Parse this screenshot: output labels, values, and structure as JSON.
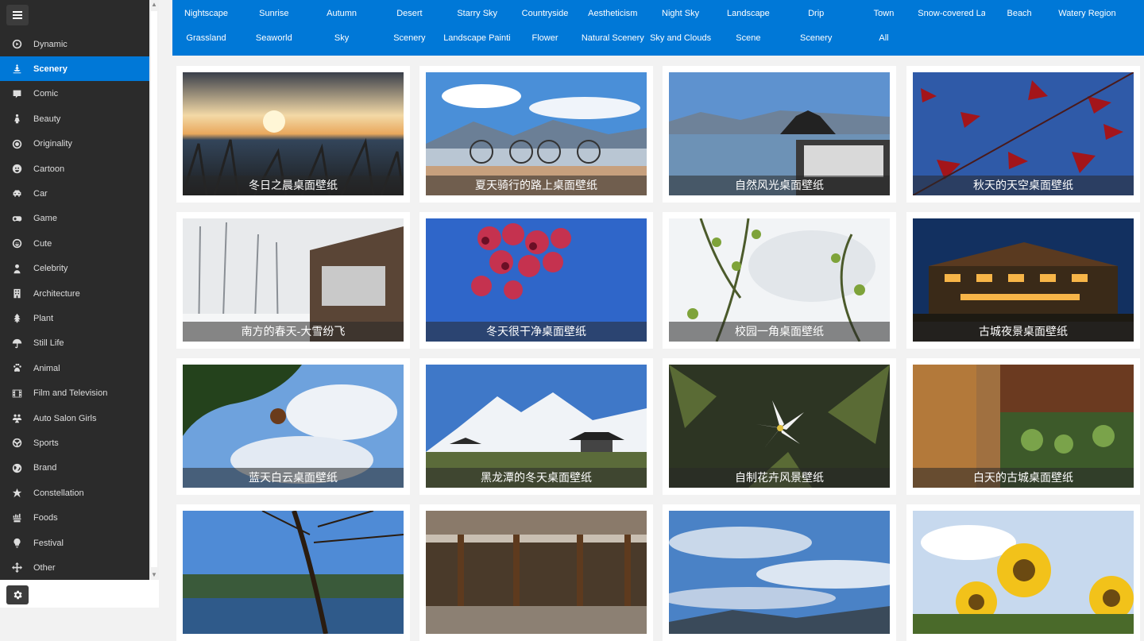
{
  "sidebar": {
    "items": [
      {
        "label": "Dynamic",
        "icon": "play-circle-icon"
      },
      {
        "label": "Scenery",
        "icon": "scenery-icon",
        "active": true
      },
      {
        "label": "Comic",
        "icon": "comic-icon"
      },
      {
        "label": "Beauty",
        "icon": "beauty-icon"
      },
      {
        "label": "Originality",
        "icon": "originality-icon"
      },
      {
        "label": "Cartoon",
        "icon": "cartoon-icon"
      },
      {
        "label": "Car",
        "icon": "car-icon"
      },
      {
        "label": "Game",
        "icon": "gamepad-icon"
      },
      {
        "label": "Cute",
        "icon": "smiley-icon"
      },
      {
        "label": "Celebrity",
        "icon": "person-icon"
      },
      {
        "label": "Architecture",
        "icon": "building-icon"
      },
      {
        "label": "Plant",
        "icon": "tree-icon"
      },
      {
        "label": "Still Life",
        "icon": "umbrella-icon"
      },
      {
        "label": "Animal",
        "icon": "paw-icon"
      },
      {
        "label": "Film and Television",
        "icon": "film-icon"
      },
      {
        "label": "Auto Salon Girls",
        "icon": "group-icon"
      },
      {
        "label": "Sports",
        "icon": "ball-icon"
      },
      {
        "label": "Brand",
        "icon": "globe-icon"
      },
      {
        "label": "Constellation",
        "icon": "star-icon"
      },
      {
        "label": "Foods",
        "icon": "food-icon"
      },
      {
        "label": "Festival",
        "icon": "bulb-icon"
      },
      {
        "label": "Other",
        "icon": "move-icon"
      }
    ]
  },
  "categories": [
    "Nightscape",
    "Sunrise",
    "Autumn",
    "Desert",
    "Starry Sky",
    "Countryside",
    "Aestheticism",
    "Night Sky",
    "Landscape",
    "Drip",
    "Town",
    "Snow-covered Lan",
    "Beach",
    "Watery Region",
    "Grassland",
    "Seaworld",
    "Sky",
    "Scenery",
    "Landscape Paintir",
    "Flower",
    "Natural Scenery",
    "Sky and Clouds",
    "Scene",
    "Scenery",
    "All"
  ],
  "wallpapers": [
    {
      "caption": "冬日之晨桌面壁纸"
    },
    {
      "caption": "夏天骑行的路上桌面壁纸"
    },
    {
      "caption": "自然风光桌面壁纸"
    },
    {
      "caption": "秋天的天空桌面壁纸"
    },
    {
      "caption": "南方的春天-大雪纷飞"
    },
    {
      "caption": "冬天很干净桌面壁纸"
    },
    {
      "caption": "校园一角桌面壁纸"
    },
    {
      "caption": "古城夜景桌面壁纸"
    },
    {
      "caption": "蓝天白云桌面壁纸"
    },
    {
      "caption": "黑龙潭的冬天桌面壁纸"
    },
    {
      "caption": "自制花卉风景壁纸"
    },
    {
      "caption": "白天的古城桌面壁纸"
    },
    {
      "caption": ""
    },
    {
      "caption": ""
    },
    {
      "caption": ""
    },
    {
      "caption": ""
    }
  ],
  "colors": {
    "accent": "#0078d7",
    "sidebar_bg": "#2b2b2b"
  }
}
